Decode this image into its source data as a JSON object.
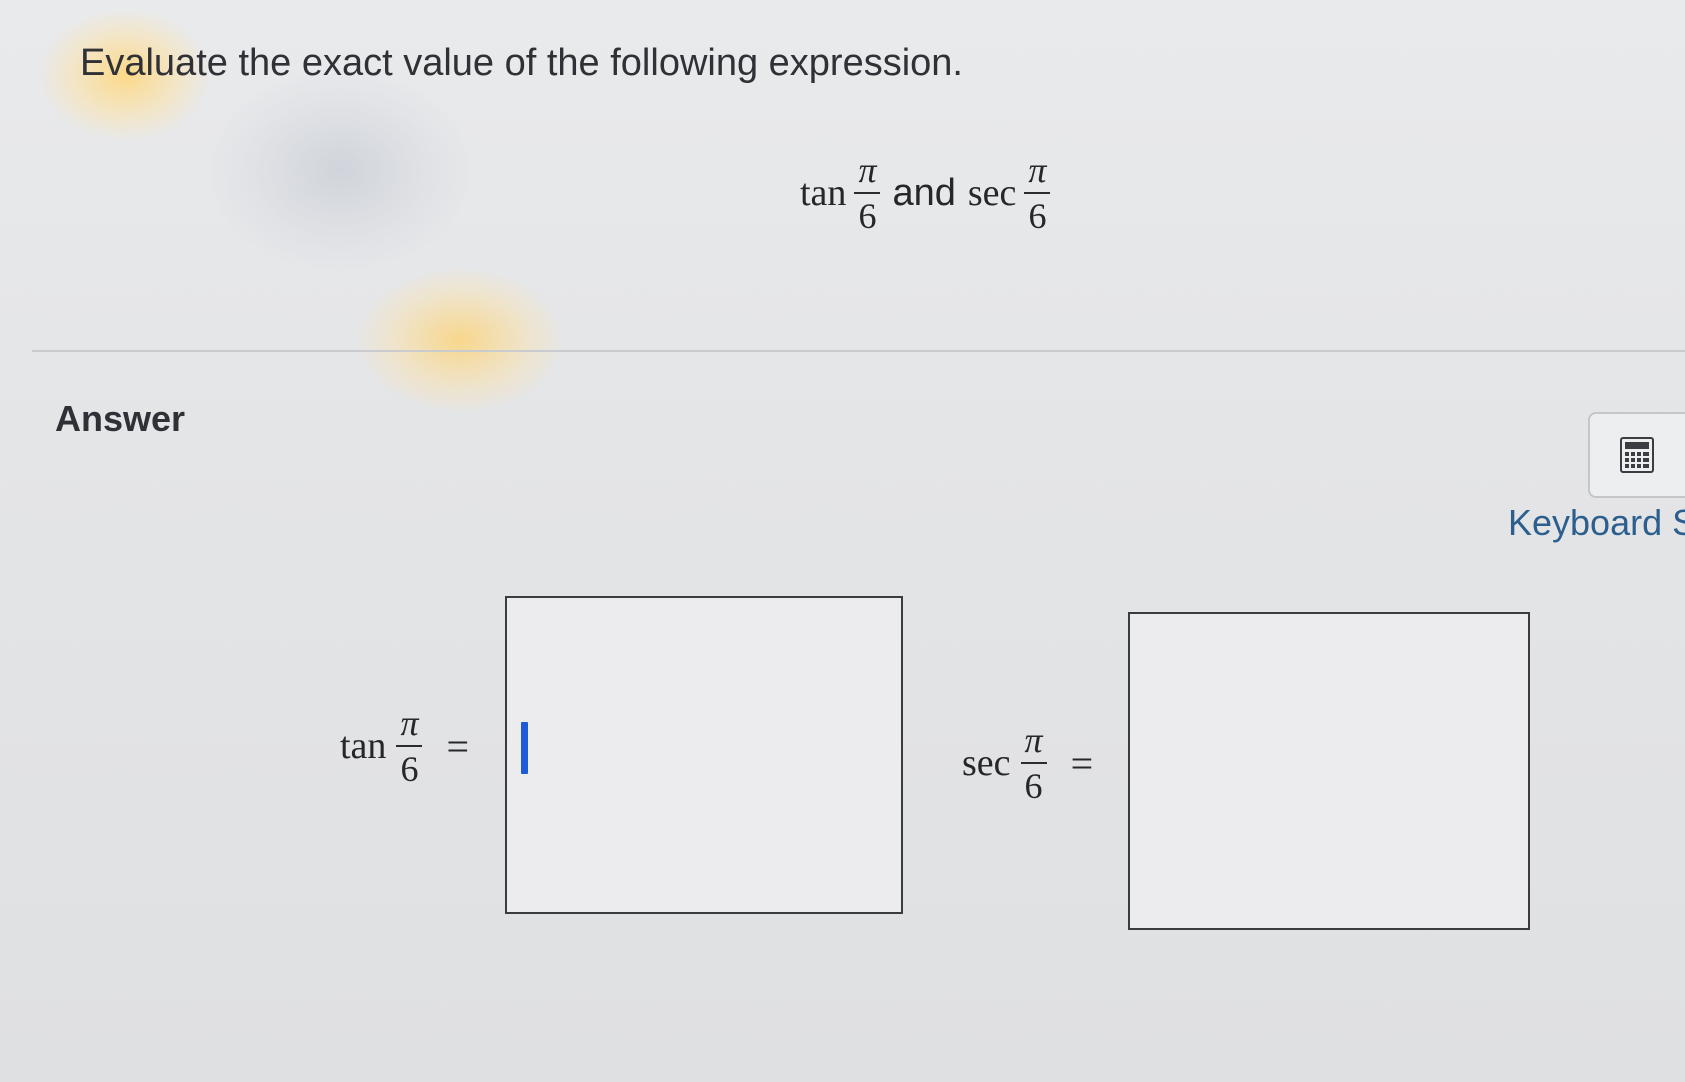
{
  "question": {
    "prompt": "Evaluate the exact value of the following expression.",
    "expression": {
      "func1": "tan",
      "func2": "sec",
      "connector": "and",
      "numerator": "π",
      "denominator": "6"
    }
  },
  "answer": {
    "label": "Answer",
    "calculator_icon": "calculator-icon",
    "keyboard_label": "Keyboard S",
    "fields": [
      {
        "func": "tan",
        "numerator": "π",
        "denominator": "6",
        "equals": "=",
        "value": ""
      },
      {
        "func": "sec",
        "numerator": "π",
        "denominator": "6",
        "equals": "=",
        "value": ""
      }
    ]
  },
  "colors": {
    "background": "#e6e7e9",
    "caret": "#1f5bd6",
    "link": "#2d5f8e"
  }
}
